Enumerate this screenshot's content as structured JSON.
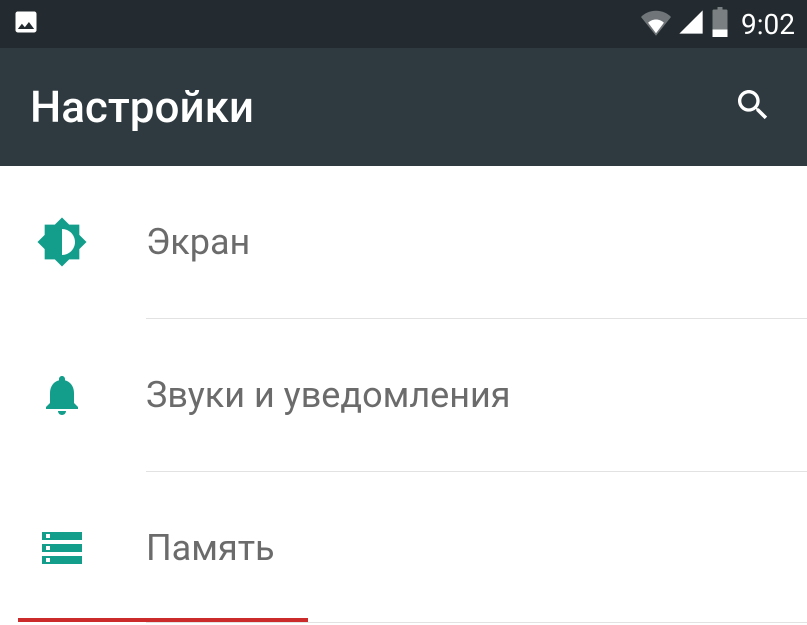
{
  "status": {
    "time": "9:02"
  },
  "header": {
    "title": "Настройки"
  },
  "settings": {
    "items": [
      {
        "label": "Экран"
      },
      {
        "label": "Звуки и уведомления"
      },
      {
        "label": "Память"
      }
    ]
  },
  "colors": {
    "accent": "#139e8c",
    "statusBar": "#232b30",
    "appBar": "#2f3a40",
    "highlight": "#cc2b2b"
  }
}
